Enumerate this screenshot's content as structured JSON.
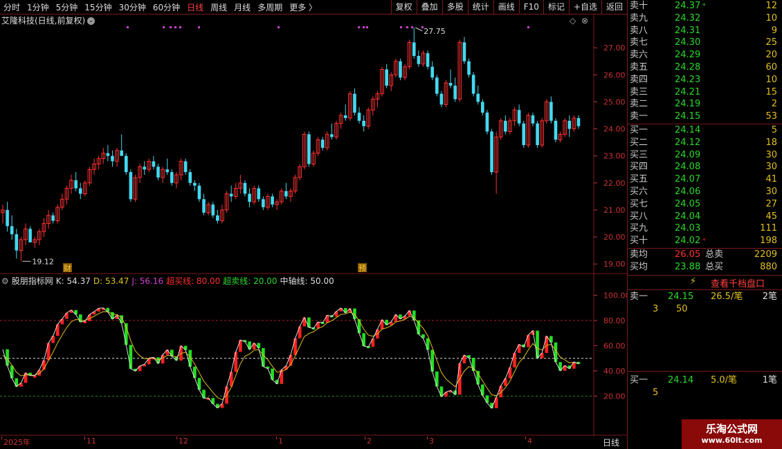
{
  "toolbar": {
    "periods": [
      "分时",
      "1分钟",
      "5分钟",
      "15分钟",
      "30分钟",
      "60分钟",
      "日线",
      "周线",
      "月线",
      "多周期",
      "更多 〉"
    ],
    "active_period": "日线",
    "tools": [
      "复权",
      "叠加",
      "多股",
      "统计",
      "画线",
      "F10",
      "标记",
      "+自选",
      "返回"
    ]
  },
  "main_chart": {
    "title": "艾隆科技(日线,前复权)",
    "y_ticks": [
      "27.00",
      "26.00",
      "25.00",
      "24.00",
      "23.00",
      "22.00",
      "21.00",
      "20.00",
      "19.00"
    ],
    "high_label": "27.75",
    "low_label": "19.12",
    "marker_cai": "财",
    "marker_yu": "预",
    "colors": {
      "up": "#ff3333",
      "down": "#44d8f0"
    }
  },
  "chart_data": [
    {
      "type": "candlestick",
      "title": "艾隆科技(日线,前复权)",
      "ylim": [
        18.8,
        27.9
      ],
      "y_ticks": [
        19,
        20,
        21,
        22,
        23,
        24,
        25,
        26,
        27
      ],
      "x_ticks": [
        "2025年",
        "11",
        "12",
        "1",
        "2",
        "3",
        "4"
      ],
      "annotations": [
        {
          "text": "27.75",
          "value": 27.75
        },
        {
          "text": "19.12",
          "value": 19.12
        }
      ],
      "ohlc": [
        [
          20.9,
          21.2,
          20.5,
          21.0
        ],
        [
          21.0,
          21.3,
          20.2,
          20.4
        ],
        [
          20.4,
          20.8,
          19.9,
          20.1
        ],
        [
          20.1,
          20.3,
          19.2,
          19.5
        ],
        [
          19.5,
          20.0,
          19.1,
          19.9
        ],
        [
          19.9,
          20.5,
          19.7,
          20.3
        ],
        [
          20.3,
          20.4,
          19.8,
          19.8
        ],
        [
          19.8,
          20.0,
          19.6,
          19.9
        ],
        [
          19.9,
          20.3,
          19.7,
          20.2
        ],
        [
          20.2,
          20.7,
          20.0,
          20.5
        ],
        [
          20.5,
          21.0,
          20.3,
          20.8
        ],
        [
          20.8,
          20.9,
          20.5,
          20.6
        ],
        [
          20.6,
          21.2,
          20.5,
          21.1
        ],
        [
          21.1,
          21.6,
          21.0,
          21.4
        ],
        [
          21.4,
          21.9,
          21.2,
          21.8
        ],
        [
          21.8,
          22.3,
          21.6,
          22.1
        ],
        [
          22.1,
          22.4,
          21.7,
          21.8
        ],
        [
          21.8,
          22.0,
          21.4,
          21.6
        ],
        [
          21.6,
          22.1,
          21.5,
          22.0
        ],
        [
          22.0,
          22.6,
          21.9,
          22.5
        ],
        [
          22.5,
          22.9,
          22.3,
          22.7
        ],
        [
          22.7,
          23.0,
          22.5,
          22.9
        ],
        [
          22.9,
          23.3,
          22.7,
          23.1
        ],
        [
          23.1,
          23.4,
          22.8,
          23.0
        ],
        [
          23.0,
          23.2,
          22.6,
          22.8
        ],
        [
          22.8,
          23.3,
          22.6,
          23.2
        ],
        [
          23.2,
          23.8,
          23.0,
          23.0
        ],
        [
          23.0,
          23.1,
          22.3,
          22.4
        ],
        [
          22.4,
          22.5,
          21.3,
          21.4
        ],
        [
          21.4,
          22.3,
          21.3,
          22.2
        ],
        [
          22.2,
          22.7,
          22.0,
          22.6
        ],
        [
          22.6,
          22.8,
          22.3,
          22.5
        ],
        [
          22.5,
          22.9,
          22.4,
          22.8
        ],
        [
          22.8,
          23.0,
          22.5,
          22.6
        ],
        [
          22.6,
          22.7,
          22.1,
          22.2
        ],
        [
          22.2,
          22.6,
          22.0,
          22.5
        ],
        [
          22.5,
          22.9,
          22.3,
          22.4
        ],
        [
          22.4,
          22.5,
          21.9,
          22.0
        ],
        [
          22.0,
          22.4,
          21.8,
          22.3
        ],
        [
          22.3,
          22.9,
          22.1,
          22.8
        ],
        [
          22.8,
          22.9,
          22.3,
          22.4
        ],
        [
          22.4,
          22.5,
          21.9,
          22.0
        ],
        [
          22.0,
          22.1,
          21.7,
          21.9
        ],
        [
          21.9,
          22.0,
          21.3,
          21.4
        ],
        [
          21.4,
          21.6,
          20.8,
          20.9
        ],
        [
          20.9,
          21.3,
          20.8,
          21.2
        ],
        [
          21.2,
          21.3,
          20.7,
          20.8
        ],
        [
          20.8,
          21.0,
          20.5,
          20.6
        ],
        [
          20.6,
          21.2,
          20.5,
          21.0
        ],
        [
          21.0,
          21.7,
          20.9,
          21.6
        ],
        [
          21.6,
          21.9,
          21.3,
          21.5
        ],
        [
          21.5,
          22.0,
          21.4,
          21.8
        ],
        [
          21.8,
          22.3,
          21.6,
          22.0
        ],
        [
          22.0,
          22.1,
          21.5,
          21.6
        ],
        [
          21.6,
          21.8,
          21.1,
          21.3
        ],
        [
          21.3,
          21.9,
          21.2,
          21.8
        ],
        [
          21.8,
          21.9,
          21.3,
          21.4
        ],
        [
          21.4,
          21.5,
          21.0,
          21.1
        ],
        [
          21.1,
          21.6,
          21.0,
          21.5
        ],
        [
          21.5,
          21.6,
          21.1,
          21.2
        ],
        [
          21.2,
          21.4,
          21.0,
          21.3
        ],
        [
          21.3,
          21.8,
          21.2,
          21.7
        ],
        [
          21.7,
          22.0,
          21.4,
          21.5
        ],
        [
          21.5,
          21.8,
          21.3,
          21.7
        ],
        [
          21.7,
          22.3,
          21.6,
          22.2
        ],
        [
          22.2,
          22.7,
          22.1,
          22.6
        ],
        [
          22.6,
          23.9,
          22.5,
          23.8
        ],
        [
          23.8,
          23.9,
          22.6,
          22.7
        ],
        [
          22.7,
          23.2,
          22.6,
          23.1
        ],
        [
          23.1,
          23.7,
          23.0,
          23.6
        ],
        [
          23.6,
          23.7,
          23.2,
          23.3
        ],
        [
          23.3,
          23.9,
          23.2,
          23.8
        ],
        [
          23.8,
          24.2,
          23.6,
          23.7
        ],
        [
          23.7,
          24.3,
          23.6,
          24.2
        ],
        [
          24.2,
          24.6,
          24.0,
          24.5
        ],
        [
          24.5,
          24.9,
          24.3,
          24.4
        ],
        [
          24.4,
          25.4,
          24.3,
          25.3
        ],
        [
          25.3,
          25.5,
          24.5,
          24.6
        ],
        [
          24.6,
          24.8,
          24.2,
          24.3
        ],
        [
          24.3,
          24.5,
          23.9,
          24.1
        ],
        [
          24.1,
          24.8,
          24.0,
          24.7
        ],
        [
          24.7,
          25.2,
          24.5,
          25.1
        ],
        [
          25.1,
          25.4,
          24.8,
          25.3
        ],
        [
          25.3,
          26.3,
          25.2,
          26.2
        ],
        [
          26.2,
          26.4,
          25.5,
          25.6
        ],
        [
          25.6,
          26.1,
          25.4,
          26.0
        ],
        [
          26.0,
          26.6,
          25.9,
          26.5
        ],
        [
          26.5,
          26.6,
          25.8,
          25.9
        ],
        [
          25.9,
          26.4,
          25.8,
          26.3
        ],
        [
          26.3,
          27.3,
          26.2,
          27.2
        ],
        [
          27.2,
          27.75,
          26.6,
          26.7
        ],
        [
          26.7,
          26.9,
          26.3,
          26.4
        ],
        [
          26.4,
          26.9,
          26.3,
          26.8
        ],
        [
          26.8,
          26.9,
          26.2,
          26.3
        ],
        [
          26.3,
          26.5,
          25.8,
          25.9
        ],
        [
          25.9,
          26.0,
          25.2,
          25.3
        ],
        [
          25.3,
          25.4,
          24.8,
          24.9
        ],
        [
          24.9,
          25.8,
          24.8,
          25.7
        ],
        [
          25.7,
          26.2,
          25.5,
          25.6
        ],
        [
          25.6,
          25.9,
          25.0,
          25.1
        ],
        [
          25.1,
          27.3,
          25.0,
          27.2
        ],
        [
          27.2,
          27.4,
          26.4,
          26.5
        ],
        [
          26.5,
          26.6,
          25.9,
          26.0
        ],
        [
          26.0,
          26.1,
          25.2,
          25.3
        ],
        [
          25.3,
          25.6,
          24.9,
          25.0
        ],
        [
          25.0,
          25.1,
          24.5,
          24.6
        ],
        [
          24.6,
          24.7,
          23.8,
          23.9
        ],
        [
          23.9,
          24.0,
          22.3,
          22.4
        ],
        [
          22.4,
          23.9,
          21.6,
          23.7
        ],
        [
          23.7,
          24.4,
          23.6,
          24.3
        ],
        [
          24.3,
          24.5,
          23.8,
          23.9
        ],
        [
          23.9,
          24.4,
          23.8,
          24.3
        ],
        [
          24.3,
          24.8,
          24.1,
          24.7
        ],
        [
          24.7,
          24.9,
          24.1,
          24.2
        ],
        [
          24.2,
          24.3,
          23.3,
          23.4
        ],
        [
          23.4,
          24.6,
          23.3,
          24.5
        ],
        [
          24.5,
          24.6,
          24.1,
          24.2
        ],
        [
          24.2,
          24.3,
          23.3,
          23.4
        ],
        [
          23.4,
          24.4,
          23.3,
          24.3
        ],
        [
          24.3,
          25.1,
          24.2,
          25.0
        ],
        [
          25.0,
          25.2,
          24.2,
          24.3
        ],
        [
          24.3,
          24.4,
          23.5,
          23.6
        ],
        [
          23.6,
          23.9,
          23.5,
          23.8
        ],
        [
          23.8,
          24.4,
          23.7,
          24.3
        ],
        [
          24.3,
          24.5,
          23.7,
          24.0
        ],
        [
          24.0,
          24.5,
          23.9,
          24.4
        ],
        [
          24.4,
          24.5,
          24.0,
          24.1
        ]
      ]
    },
    {
      "type": "line",
      "title": "股朋指标网",
      "ylim": [
        0,
        115
      ],
      "y_ticks": [
        20,
        40,
        60,
        80,
        100
      ],
      "reference_lines": [
        {
          "name": "超买线",
          "value": 80
        },
        {
          "name": "超卖线",
          "value": 20
        },
        {
          "name": "中轴线",
          "value": 50
        }
      ],
      "series": [
        {
          "name": "K",
          "last": 54.37
        },
        {
          "name": "D",
          "last": 53.47
        },
        {
          "name": "J",
          "last": 56.16
        }
      ]
    }
  ],
  "osc_chart": {
    "name": "股朋指标网",
    "legend": [
      {
        "text": "K: 54.37",
        "color": "#dddddd"
      },
      {
        "text": "D: 53.47",
        "color": "#e0c020"
      },
      {
        "text": "J: 56.16",
        "color": "#d040d0"
      },
      {
        "text": "超买线: 80.00",
        "color": "#ff3030"
      },
      {
        "text": "超卖线: 20.00",
        "color": "#2bd92b"
      },
      {
        "text": "中轴线: 50.00",
        "color": "#dddddd"
      }
    ],
    "y_ticks": [
      "100.00",
      "80.00",
      "60.00",
      "40.00",
      "20.00"
    ]
  },
  "date_axis": [
    "2025年",
    "11",
    "12",
    "1",
    "2",
    "3",
    "4"
  ],
  "period_label": "日线",
  "quotes": {
    "sell": [
      {
        "label": "卖十",
        "price": "24.37",
        "vol": "12",
        "star": "*"
      },
      {
        "label": "卖九",
        "price": "24.32",
        "vol": "10",
        "star": ""
      },
      {
        "label": "卖八",
        "price": "24.31",
        "vol": "9",
        "star": ""
      },
      {
        "label": "卖七",
        "price": "24.30",
        "vol": "25",
        "star": ""
      },
      {
        "label": "卖六",
        "price": "24.29",
        "vol": "20",
        "star": ""
      },
      {
        "label": "卖五",
        "price": "24.28",
        "vol": "60",
        "star": ""
      },
      {
        "label": "卖四",
        "price": "24.23",
        "vol": "10",
        "star": ""
      },
      {
        "label": "卖三",
        "price": "24.21",
        "vol": "15",
        "star": ""
      },
      {
        "label": "卖二",
        "price": "24.19",
        "vol": "2",
        "star": ""
      },
      {
        "label": "卖一",
        "price": "24.15",
        "vol": "53",
        "star": ""
      }
    ],
    "buy": [
      {
        "label": "买一",
        "price": "24.14",
        "vol": "5",
        "star": ""
      },
      {
        "label": "买二",
        "price": "24.12",
        "vol": "18",
        "star": ""
      },
      {
        "label": "买三",
        "price": "24.09",
        "vol": "30",
        "star": ""
      },
      {
        "label": "买四",
        "price": "24.08",
        "vol": "30",
        "star": ""
      },
      {
        "label": "买五",
        "price": "24.07",
        "vol": "41",
        "star": ""
      },
      {
        "label": "买六",
        "price": "24.06",
        "vol": "30",
        "star": ""
      },
      {
        "label": "买七",
        "price": "24.05",
        "vol": "27",
        "star": ""
      },
      {
        "label": "买八",
        "price": "24.04",
        "vol": "45",
        "star": ""
      },
      {
        "label": "买九",
        "price": "24.03",
        "vol": "111",
        "star": ""
      },
      {
        "label": "买十",
        "price": "24.02",
        "vol": "198",
        "star": "*"
      }
    ],
    "avg_sell": {
      "label": "卖均",
      "price": "26.05",
      "total_label": "总卖",
      "total": "2209"
    },
    "avg_buy": {
      "label": "买均",
      "price": "23.88",
      "total_label": "总买",
      "total": "880"
    }
  },
  "level2": {
    "button": "查看千档盘口",
    "sell1": {
      "label": "卖一",
      "price": "24.15",
      "size": "26.5/笔",
      "count": "2笔",
      "orders": [
        "3",
        "50"
      ]
    },
    "buy1": {
      "label": "买一",
      "price": "24.14",
      "size": "5.0/笔",
      "count": "1笔",
      "orders": [
        "5"
      ]
    }
  },
  "watermark": {
    "line1": "乐淘公式网",
    "line2": "www.60lt.com"
  }
}
